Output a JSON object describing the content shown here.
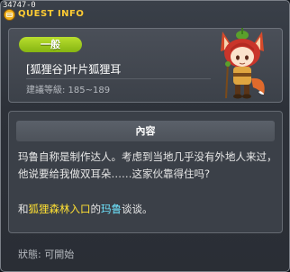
{
  "window": {
    "quest_id": "34747-0",
    "title": "QUEST INFO"
  },
  "header": {
    "category": "一般",
    "quest_name": "[狐狸谷]叶片狐狸耳",
    "rec_level": "建議等級: 185~189"
  },
  "content": {
    "section_title": "內容",
    "description": "玛鲁自称是制作达人。考虑到当地几乎没有外地人来过，他说要给我做双耳朵……这家伙靠得住吗?",
    "hint_prefix": "和",
    "hint_map": "狐狸森林入口",
    "hint_middle": "的",
    "hint_npc": "玛鲁",
    "hint_suffix": "谈谈。"
  },
  "status": "狀態: 可開始",
  "colors": {
    "title": "#ffcc33",
    "badge": "#a4cd1e",
    "map_highlight": "#ffe033",
    "npc_highlight": "#6fe5ff"
  }
}
